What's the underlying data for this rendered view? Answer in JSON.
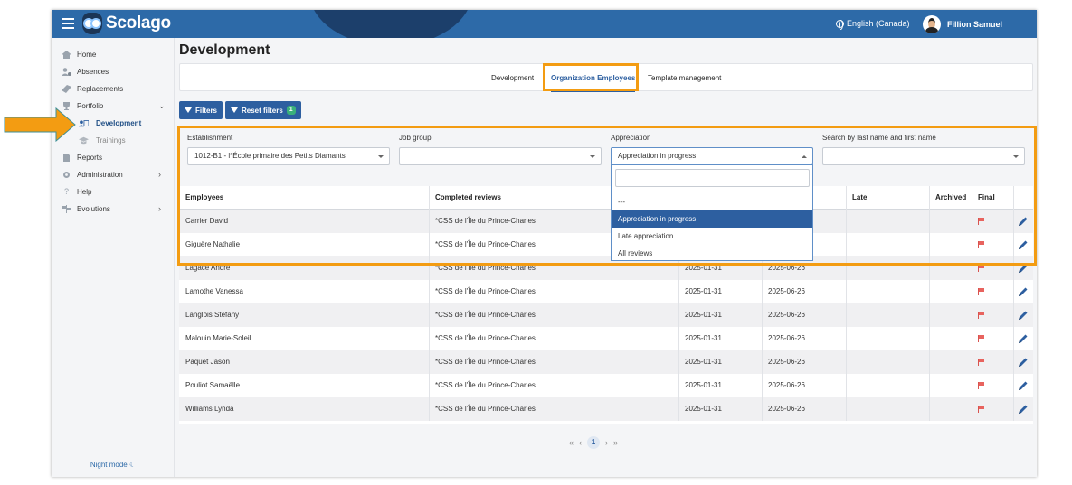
{
  "app": {
    "brand": "Scolago",
    "language": "English (Canada)",
    "user_name": "Fillion Samuel"
  },
  "sidebar": {
    "items": [
      {
        "label": "Home",
        "icon": "home-icon"
      },
      {
        "label": "Absences",
        "icon": "user-clock-icon"
      },
      {
        "label": "Replacements",
        "icon": "swap-icon"
      },
      {
        "label": "Portfolio",
        "icon": "trophy-icon"
      },
      {
        "label": "Development",
        "icon": "id-card-icon"
      },
      {
        "label": "Trainings",
        "icon": "graduation-cap-icon"
      },
      {
        "label": "Reports",
        "icon": "document-icon"
      },
      {
        "label": "Administration",
        "icon": "gear-icon"
      },
      {
        "label": "Help",
        "icon": "question-icon"
      },
      {
        "label": "Evolutions",
        "icon": "signpost-icon"
      }
    ],
    "night_mode": "Night mode"
  },
  "page": {
    "title": "Development",
    "tabs": [
      "Development",
      "Organization Employees",
      "Template management"
    ],
    "active_tab": "Organization Employees"
  },
  "toolbar": {
    "filters_label": "Filters",
    "reset_label": "Reset filters",
    "reset_count": "1"
  },
  "filters": {
    "establishment_label": "Establishment",
    "establishment_value": "1012-B1 - l*École primaire des Petits Diamants",
    "job_group_label": "Job group",
    "job_group_value": "",
    "appreciation_label": "Appreciation",
    "appreciation_value": "Appreciation in progress",
    "search_label": "Search by last name and first name",
    "search_value": ""
  },
  "appreciation_dropdown": {
    "options": [
      "---",
      "Appreciation in progress",
      "Late appreciation",
      "All reviews"
    ],
    "selected": "Appreciation in progress"
  },
  "table": {
    "columns": [
      "Employees",
      "Completed reviews",
      "",
      "",
      "Late",
      "Archived",
      "Final"
    ],
    "rows": [
      {
        "employee": "Carrier David",
        "org": "*CSS de l'Île du Prince-Charles",
        "start": "",
        "end": ""
      },
      {
        "employee": "Giguère Nathalie",
        "org": "*CSS de l'Île du Prince-Charles",
        "start": "",
        "end": ""
      },
      {
        "employee": "Lagacé André",
        "org": "*CSS de l'Île du Prince-Charles",
        "start": "2025-01-31",
        "end": "2025-06-26"
      },
      {
        "employee": "Lamothe Vanessa",
        "org": "*CSS de l'Île du Prince-Charles",
        "start": "2025-01-31",
        "end": "2025-06-26"
      },
      {
        "employee": "Langlois Stéfany",
        "org": "*CSS de l'Île du Prince-Charles",
        "start": "2025-01-31",
        "end": "2025-06-26"
      },
      {
        "employee": "Malouin Marie-Soleil",
        "org": "*CSS de l'Île du Prince-Charles",
        "start": "2025-01-31",
        "end": "2025-06-26"
      },
      {
        "employee": "Paquet Jason",
        "org": "*CSS de l'Île du Prince-Charles",
        "start": "2025-01-31",
        "end": "2025-06-26"
      },
      {
        "employee": "Pouliot Samaëlle",
        "org": "*CSS de l'Île du Prince-Charles",
        "start": "2025-01-31",
        "end": "2025-06-26"
      },
      {
        "employee": "Williams Lynda",
        "org": "*CSS de l'Île du Prince-Charles",
        "start": "2025-01-31",
        "end": "2025-06-26"
      }
    ]
  },
  "pagination": {
    "first": "«",
    "prev": "‹",
    "current": "1",
    "next": "›",
    "last": "»"
  },
  "colors": {
    "primary": "#2d6aa8",
    "button": "#2d5fa0",
    "highlight": "#f39c12",
    "badge": "#3ab07b",
    "flag": "#e8635e"
  }
}
